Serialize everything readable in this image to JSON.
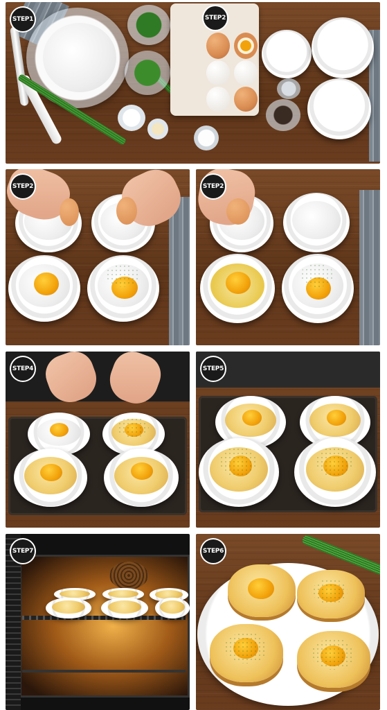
{
  "steps": [
    {
      "label": "STEP1"
    },
    {
      "label": "STEP2"
    },
    {
      "label": "STEP2"
    },
    {
      "label": "STEP4"
    },
    {
      "label": "STEP5"
    },
    {
      "label": "STEP7"
    },
    {
      "label": "STEP6"
    }
  ],
  "colors": {
    "wood": "#6b3d1f",
    "egg_brown": "#d98c52",
    "yolk": "#f2a20a",
    "chives": "#2f7a24",
    "souffle": "#f0cd6e",
    "oven_glow": "#f0b14a"
  }
}
